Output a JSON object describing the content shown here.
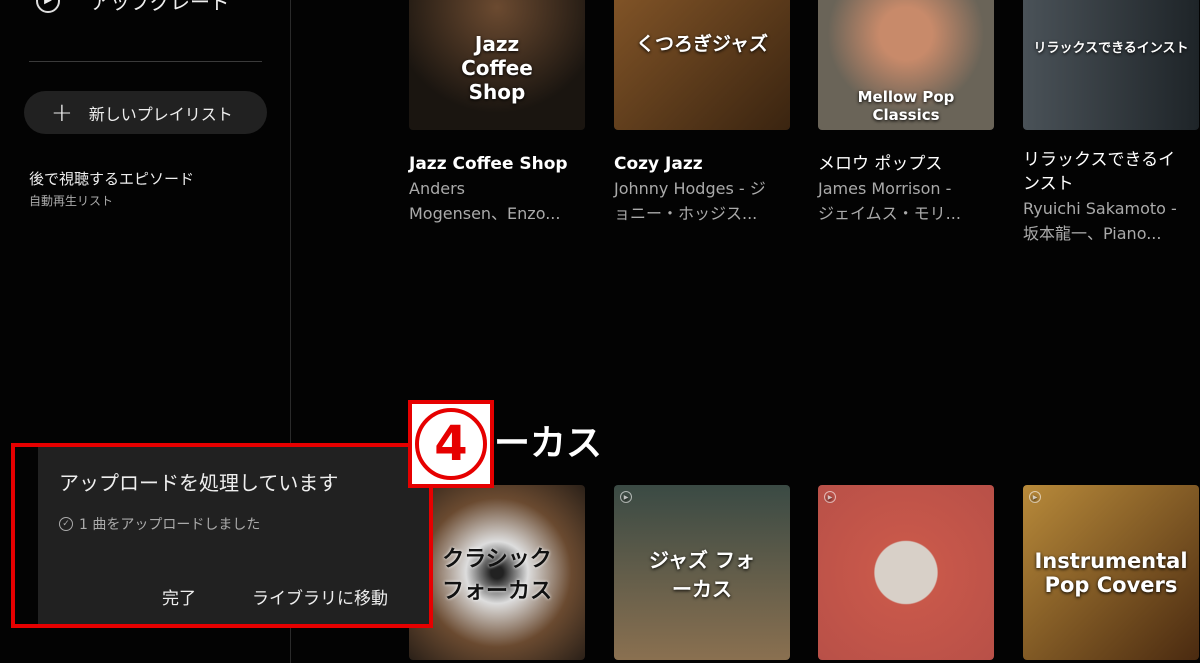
{
  "sidebar": {
    "upgrade_label": "アップグレード",
    "new_playlist": "新しいプレイリスト",
    "episodes_title": "後で視聴するエピソード",
    "episodes_sub": "自動再生リスト"
  },
  "row1": [
    {
      "art_text": "Jazz Coffee Shop",
      "title": "Jazz Coffee Shop",
      "sub1": "Anders",
      "sub2": "Mogensen、Enzo..."
    },
    {
      "art_text": "くつろぎジャズ",
      "title": "Cozy Jazz",
      "sub1": "Johnny Hodges - ジ",
      "sub2": "ョニー・ホッジス..."
    },
    {
      "art_text": "Mellow Pop Classics",
      "title": "メロウ ポップス",
      "sub1": "James Morrison -",
      "sub2": "ジェイムス・モリ..."
    },
    {
      "art_text": "リラックスできるインスト",
      "title": "リラックスできるイ",
      "title2": "ンスト",
      "sub1": "Ryuichi Sakamoto -",
      "sub2": "坂本龍一、Piano..."
    }
  ],
  "section2": {
    "heading": "ーカス",
    "cards": [
      {
        "art_text": "クラシック フォーカス"
      },
      {
        "art_text": "ジャズ フォーカス"
      },
      {
        "art_text": ""
      },
      {
        "art_text": "Instrumental Pop Covers"
      }
    ]
  },
  "toast": {
    "title": "アップロードを処理しています",
    "status": "1 曲をアップロードしました",
    "done": "完了",
    "go_library": "ライブラリに移動"
  },
  "annotation": {
    "number": "4",
    "color": "#e60000"
  }
}
